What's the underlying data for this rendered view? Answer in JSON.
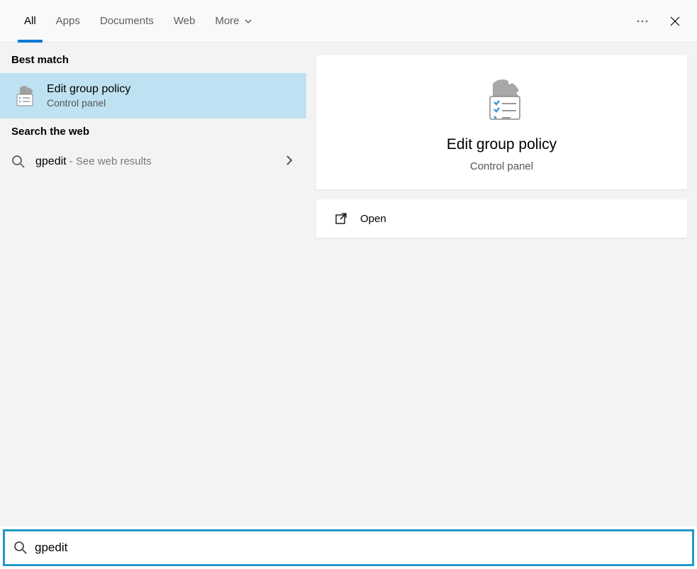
{
  "tabs": {
    "all": "All",
    "apps": "Apps",
    "documents": "Documents",
    "web": "Web",
    "more": "More"
  },
  "sections": {
    "best_match": "Best match",
    "search_web": "Search the web"
  },
  "best_match": {
    "title": "Edit group policy",
    "sub": "Control panel"
  },
  "web_result": {
    "term": "gpedit",
    "suffix": " - See web results"
  },
  "preview": {
    "title": "Edit group policy",
    "sub": "Control panel"
  },
  "actions": {
    "open": "Open"
  },
  "search": {
    "value": "gpedit"
  }
}
